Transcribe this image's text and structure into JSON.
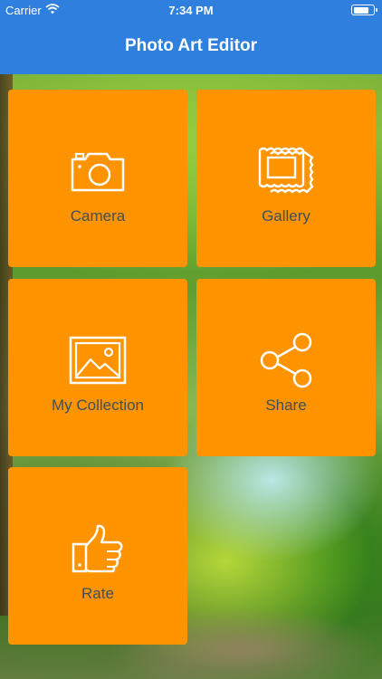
{
  "status_bar": {
    "carrier": "Carrier",
    "time": "7:34 PM",
    "wifi_icon": "wifi-icon",
    "battery_icon": "battery-icon"
  },
  "nav": {
    "title": "Photo Art Editor"
  },
  "tiles": [
    {
      "label": "Camera",
      "icon": "camera-icon"
    },
    {
      "label": "Gallery",
      "icon": "gallery-frames-icon"
    },
    {
      "label": "My Collection",
      "icon": "image-frame-icon"
    },
    {
      "label": "Share",
      "icon": "share-icon"
    },
    {
      "label": "Rate",
      "icon": "thumbs-up-icon"
    }
  ],
  "colors": {
    "nav_bar": "#2f80de",
    "tile_background": "#ff9300",
    "tile_text": "#3f5058",
    "icon_stroke": "#ffffff"
  }
}
